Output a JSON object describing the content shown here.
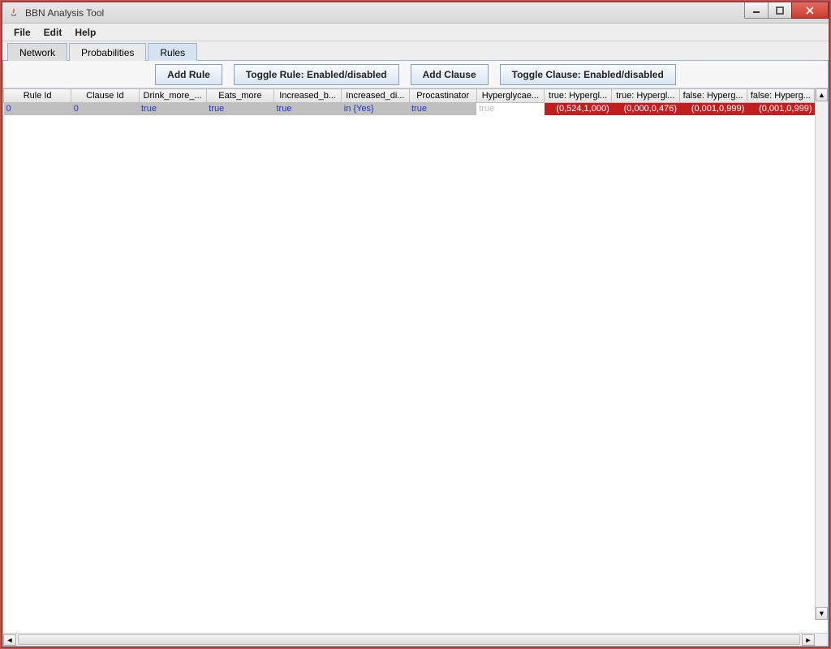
{
  "window": {
    "title": "BBN Analysis Tool"
  },
  "menu": {
    "file": "File",
    "edit": "Edit",
    "help": "Help"
  },
  "tabs": {
    "network": "Network",
    "probabilities": "Probabilities",
    "rules": "Rules"
  },
  "toolbar": {
    "add_rule": "Add Rule",
    "toggle_rule": "Toggle Rule: Enabled/disabled",
    "add_clause": "Add Clause",
    "toggle_clause": "Toggle Clause: Enabled/disabled"
  },
  "columns": [
    "Rule Id",
    "Clause Id",
    "Drink_more_...",
    "Eats_more",
    "Increased_b...",
    "Increased_di...",
    "Procastinator",
    "Hyperglycae...",
    "true: Hypergl...",
    "true: Hypergl...",
    "false: Hyperg...",
    "false: Hyperg..."
  ],
  "row0": {
    "rule_id": "0",
    "clause_id": "0",
    "drink": "true",
    "eats": "true",
    "incb": "true",
    "incd": "in {Yes}",
    "proc": "true",
    "hyper": "true",
    "t1": "(0,524,1,000)",
    "t2": "(0,000,0,476)",
    "f1": "(0,001,0,999)",
    "f2": "(0,001,0,999)"
  }
}
